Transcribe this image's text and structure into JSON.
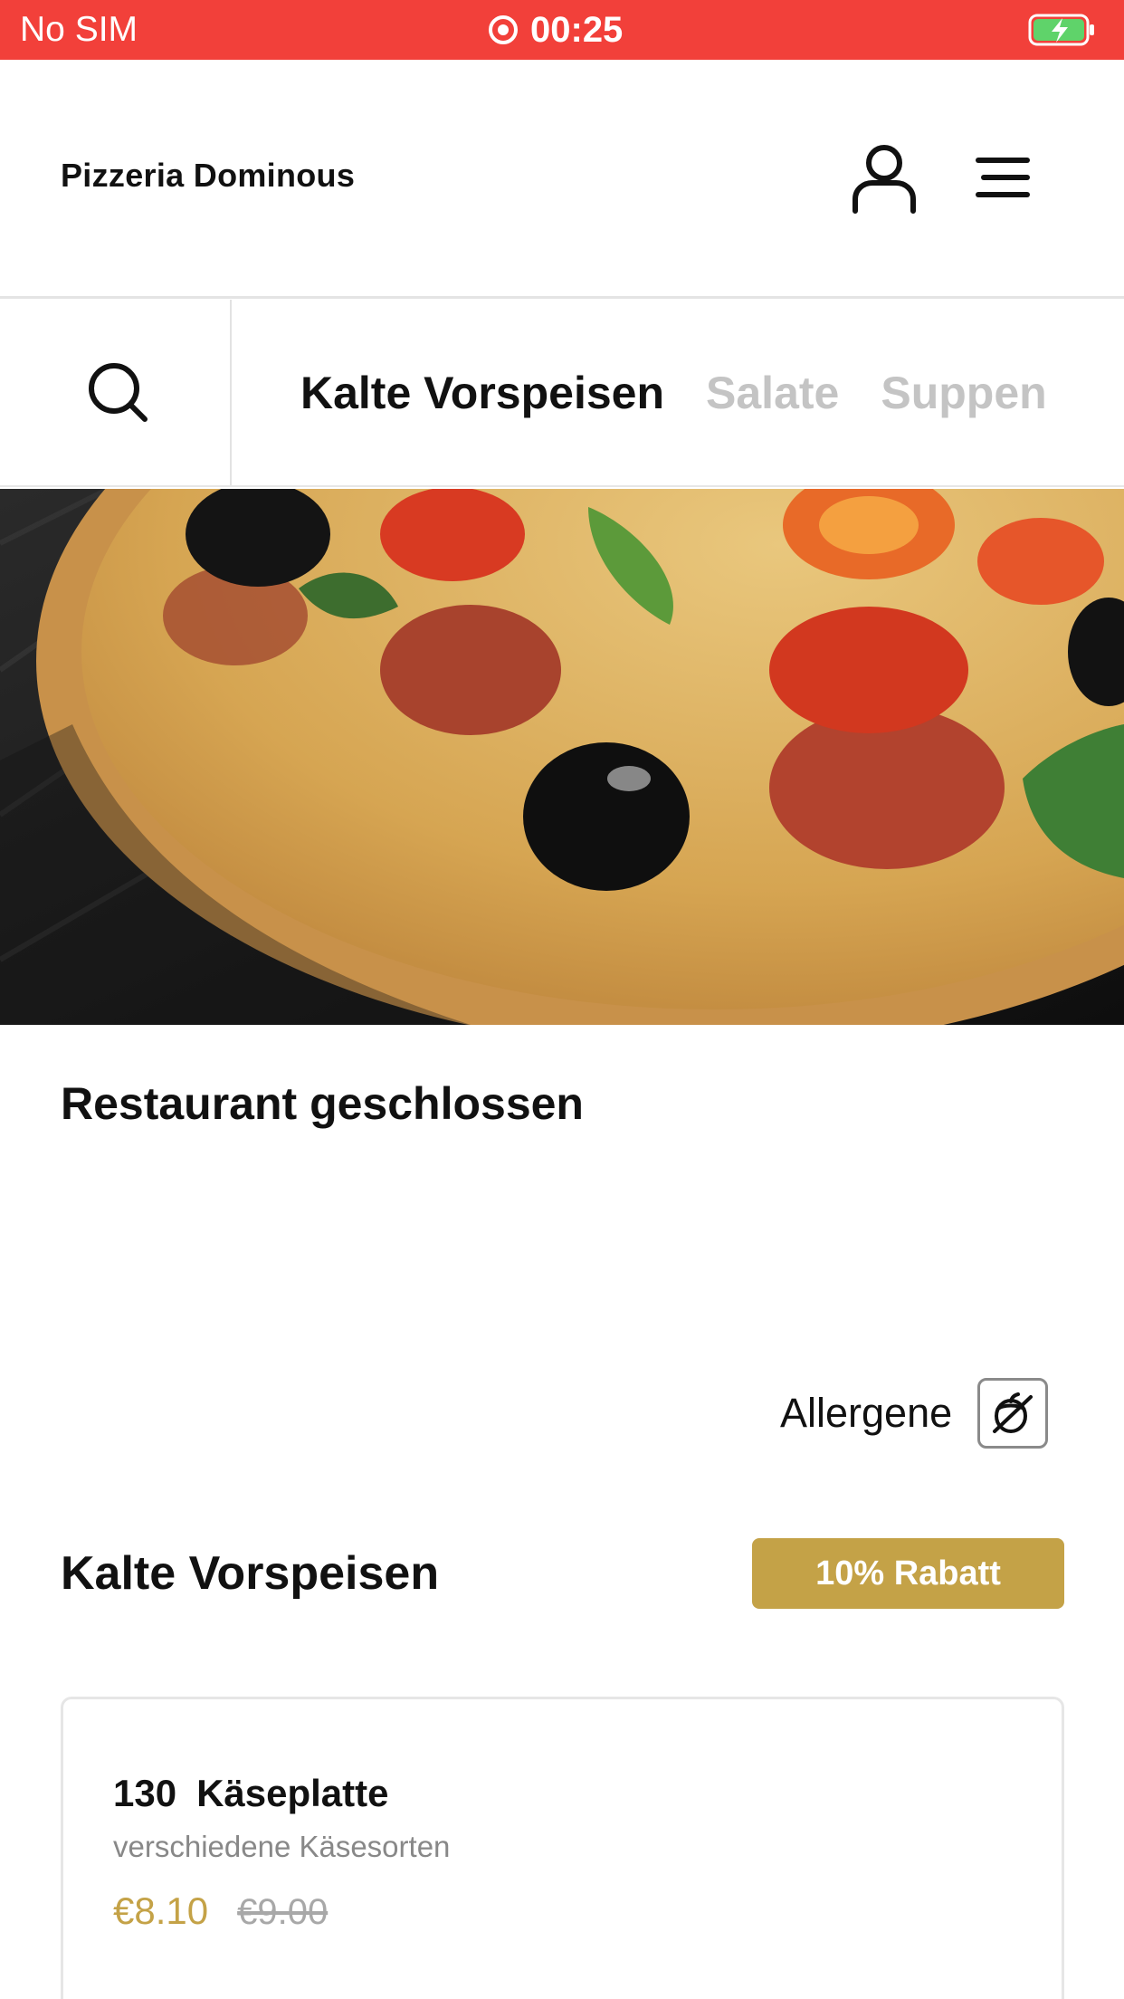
{
  "status_bar": {
    "carrier": "No SIM",
    "time": "00:25"
  },
  "header": {
    "brand": "Pizzeria Dominous",
    "icons": {
      "user": "user-icon",
      "menu": "hamburger-menu-icon"
    }
  },
  "categories": {
    "search_icon": "search-icon",
    "tabs": [
      {
        "label": "Kalte Vorspeisen",
        "active": true
      },
      {
        "label": "Salate",
        "active": false
      },
      {
        "label": "Suppen",
        "active": false
      }
    ]
  },
  "restaurant": {
    "status": "Restaurant geschlossen"
  },
  "allergens": {
    "label": "Allergene",
    "icon": "allergen-nut-icon"
  },
  "section": {
    "title": "Kalte Vorspeisen",
    "discount_badge": "10% Rabatt"
  },
  "items": [
    {
      "number": "130",
      "name": "Käseplatte",
      "description": "verschiedene Käsesorten",
      "price": "€8.10",
      "original_price": "€9.00"
    }
  ],
  "colors": {
    "status_bar": "#f2403a",
    "accent_gold": "#c4a247",
    "inactive_tab": "#c4c4c4"
  }
}
